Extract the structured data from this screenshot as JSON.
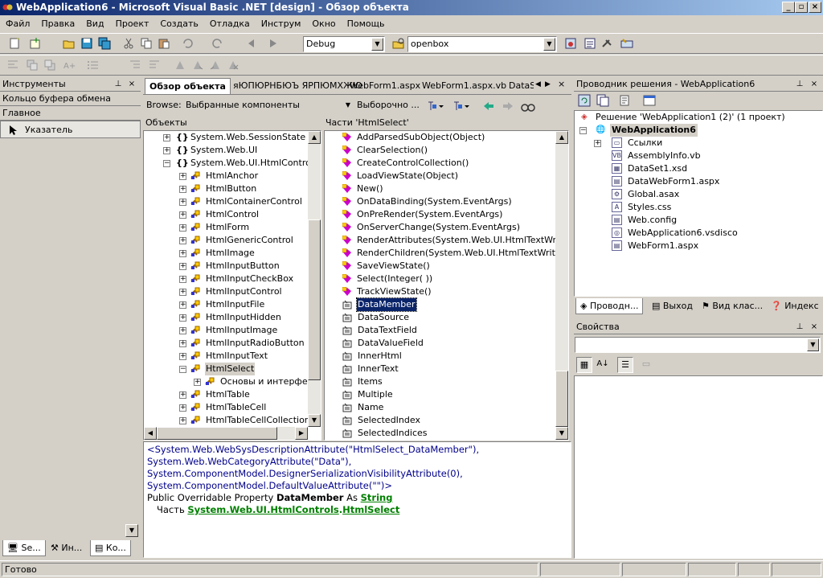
{
  "window": {
    "title": "WebApplication6 - Microsoft Visual Basic .NET [design] - Обзор объекта"
  },
  "menu": [
    "Файл",
    "Правка",
    "Вид",
    "Проект",
    "Создать",
    "Отладка",
    "Инструм",
    "Окно",
    "Помощь"
  ],
  "toolbar": {
    "config": "Debug",
    "find": "openbox"
  },
  "toolbox": {
    "title": "Инструменты",
    "sections": [
      "Кольцо буфера обмена",
      "Главное"
    ],
    "items": [
      "Указатель"
    ],
    "tabs": [
      "Se...",
      "Ин...",
      "Ко..."
    ]
  },
  "tabs": [
    "Обзор объекта",
    "яЮПЮРНБЮЪ ЯРПЮМХЖЮ",
    "WebForm1.aspx",
    "WebForm1.aspx.vb",
    "DataS"
  ],
  "browse": {
    "label": "Browse:",
    "value": "Выбранные компоненты",
    "custom": "Выборочно ..."
  },
  "objects": {
    "header": "Объекты",
    "namespaces": [
      "System.Web.SessionState",
      "System.Web.UI",
      "System.Web.UI.HtmlControls"
    ],
    "classes": [
      "HtmlAnchor",
      "HtmlButton",
      "HtmlContainerControl",
      "HtmlControl",
      "HtmlForm",
      "HtmlGenericControl",
      "HtmlImage",
      "HtmlInputButton",
      "HtmlInputCheckBox",
      "HtmlInputControl",
      "HtmlInputFile",
      "HtmlInputHidden",
      "HtmlInputImage",
      "HtmlInputRadioButton",
      "HtmlInputText",
      "HtmlSelect",
      "Основы и интерфейс",
      "HtmlTable",
      "HtmlTableCell",
      "HtmlTableCellCollection"
    ]
  },
  "members": {
    "header": "Части 'HtmlSelect'",
    "methods": [
      "AddParsedSubObject(Object)",
      "ClearSelection()",
      "CreateControlCollection()",
      "LoadViewState(Object)",
      "New()",
      "OnDataBinding(System.EventArgs)",
      "OnPreRender(System.EventArgs)",
      "OnServerChange(System.EventArgs)",
      "RenderAttributes(System.Web.UI.HtmlTextWriter)",
      "RenderChildren(System.Web.UI.HtmlTextWriter)",
      "SaveViewState()",
      "Select(Integer( ))",
      "TrackViewState()"
    ],
    "properties": [
      "DataMember",
      "DataSource",
      "DataTextField",
      "DataValueField",
      "InnerHtml",
      "InnerText",
      "Items",
      "Multiple",
      "Name",
      "SelectedIndex",
      "SelectedIndices"
    ]
  },
  "description": {
    "lines": [
      "<System.Web.WebSysDescriptionAttribute(\"HtmlSelect_DataMember\"),",
      "System.Web.WebCategoryAttribute(\"Data\"),",
      "System.ComponentModel.DesignerSerializationVisibilityAttribute(0),",
      "System.ComponentModel.DefaultValueAttribute(\"\")>"
    ],
    "decl_prefix": "Public Overridable Property ",
    "decl_name": "DataMember",
    "decl_as": " As ",
    "decl_type": "String",
    "part_label": "Часть ",
    "part_ns": "System.Web.UI.HtmlControls",
    "part_dot": ".",
    "part_class": "HtmlSelect"
  },
  "solution": {
    "title": "Проводник решения - WebApplication6",
    "root": "Решение 'WebApplication1 (2)' (1 проект)",
    "project": "WebApplication6",
    "items": [
      "Ссылки",
      "AssemblyInfo.vb",
      "DataSet1.xsd",
      "DataWebForm1.aspx",
      "Global.asax",
      "Styles.css",
      "Web.config",
      "WebApplication6.vsdisco",
      "WebForm1.aspx"
    ],
    "tabs": [
      "Проводн...",
      "Выход",
      "Вид клас...",
      "Индекс"
    ]
  },
  "properties_panel": {
    "title": "Свойства"
  },
  "status": {
    "text": "Готово"
  }
}
